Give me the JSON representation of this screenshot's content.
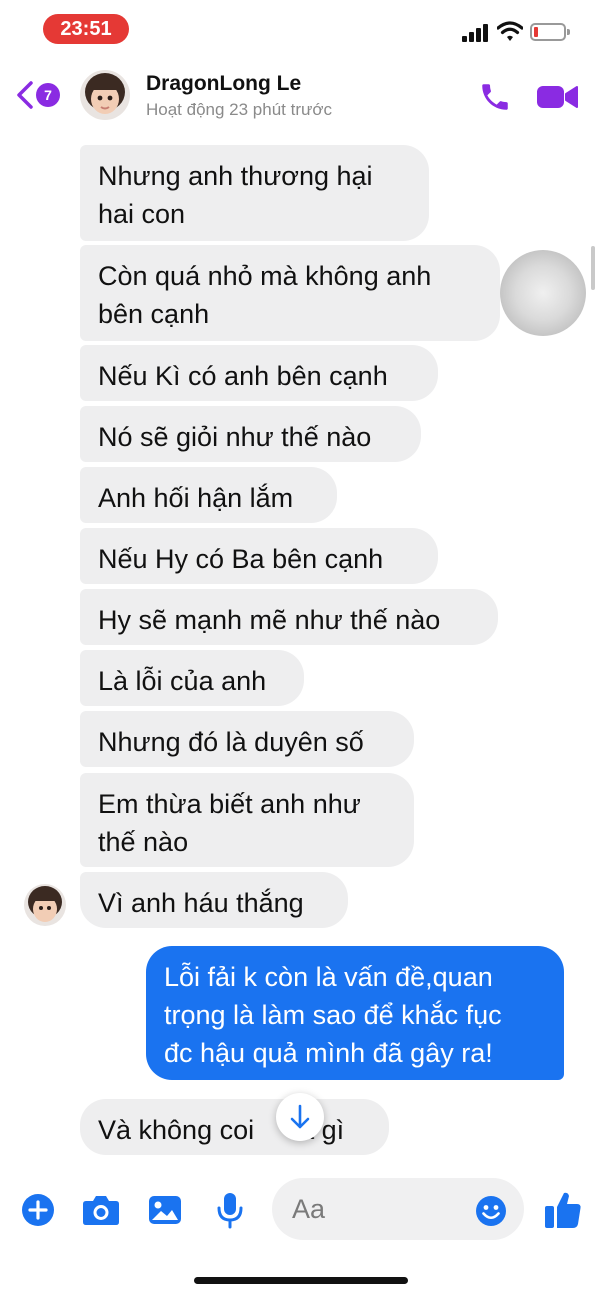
{
  "status_bar": {
    "time": "23:51"
  },
  "header": {
    "badge_count": "7",
    "contact_name": "DragonLong Le",
    "contact_status": "Hoạt động 23 phút trước"
  },
  "messages": [
    {
      "text": "Nhưng anh thương hại\nhai con",
      "direction": "in"
    },
    {
      "text": "Còn quá nhỏ mà không anh\nbên cạnh",
      "direction": "in"
    },
    {
      "text": "Nếu Kì có anh bên cạnh",
      "direction": "in"
    },
    {
      "text": "Nó sẽ giỏi như thế nào",
      "direction": "in"
    },
    {
      "text": "Anh hối hận lắm",
      "direction": "in"
    },
    {
      "text": "Nếu Hy có Ba bên cạnh",
      "direction": "in"
    },
    {
      "text": "Hy sẽ mạnh mẽ như thế nào",
      "direction": "in"
    },
    {
      "text": "Là lỗi của anh",
      "direction": "in"
    },
    {
      "text": "Nhưng đó là duyên số",
      "direction": "in"
    },
    {
      "text": "Em thừa biết anh như\nthế nào",
      "direction": "in"
    },
    {
      "text": "Vì anh háu thắng",
      "direction": "in"
    },
    {
      "text": "Lỗi fải k còn là vấn đề,quan\ntrọng là làm sao để khắc fục\nđc hậu quả mình đã gây ra!",
      "direction": "out"
    },
    {
      "text": "Và không coi      a gì",
      "direction": "in"
    }
  ],
  "composer": {
    "placeholder": "Aa"
  },
  "colors": {
    "accent": "#8a2be2",
    "outgoing_bubble": "#1a73f0",
    "incoming_bubble": "#eeeeef",
    "composer_icons": "#1a73f0",
    "time_pill": "#e53935"
  },
  "icons": [
    "back-chevron-icon",
    "phone-icon",
    "video-camera-icon",
    "plus-icon",
    "camera-icon",
    "image-icon",
    "microphone-icon",
    "emoji-icon",
    "thumbs-up-icon",
    "arrow-down-icon"
  ]
}
